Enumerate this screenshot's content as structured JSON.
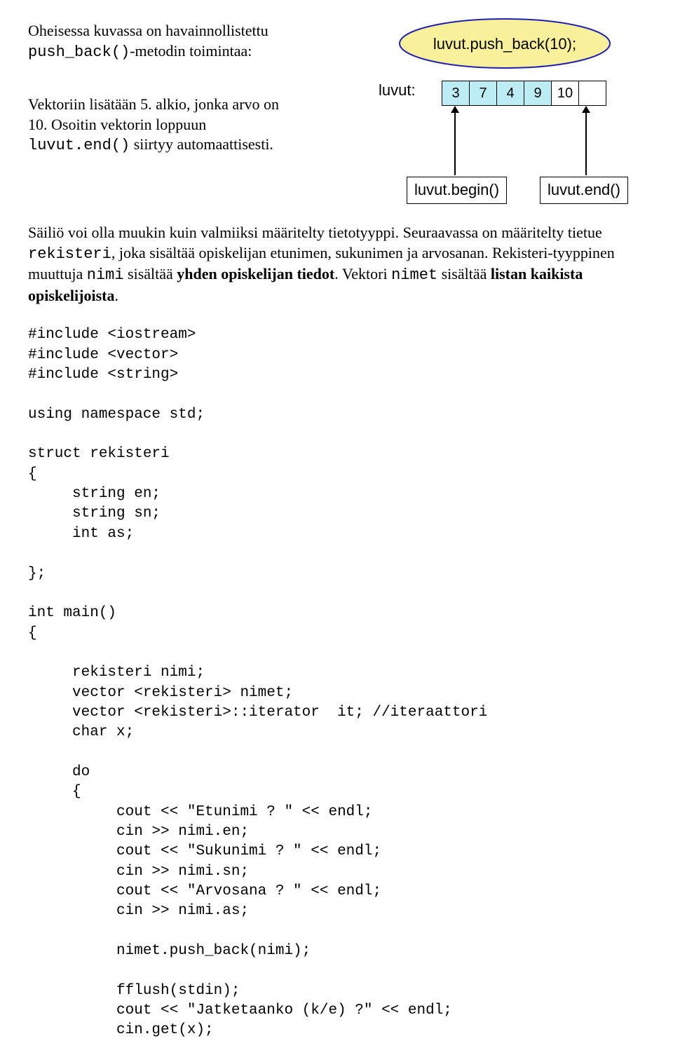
{
  "intro": {
    "p1_a": "Oheisessa kuvassa on havainnollistettu ",
    "p1_code": "push_back()",
    "p1_b": "-metodin toimintaa:",
    "p2_a": "Vektoriin lisätään 5. alkio, jonka arvo on 10. Osoitin vektorin loppuun ",
    "p2_code": "luvut.end()",
    "p2_b": " siirtyy automaattisesti."
  },
  "diagram": {
    "ellipse_text": "luvut.push_back(10);",
    "label": "luvut:",
    "cells": [
      "3",
      "7",
      "4",
      "9",
      "10",
      ""
    ],
    "begin": "luvut.begin()",
    "end": "luvut.end()"
  },
  "body": {
    "a": "Säiliö voi olla muukin kuin valmiiksi määritelty tietotyyppi. Seuraavassa on määritelty tietue ",
    "code1": "rekisteri",
    "b": ", joka sisältää opiskelijan etunimen, sukunimen ja arvosanan. Rekisteri-tyyppinen muuttuja ",
    "code2": "nimi",
    "c": " sisältää ",
    "bold1": "yhden opiskelijan tiedot",
    "d": ". Vektori ",
    "code3": "nimet",
    "e": " sisältää ",
    "bold2": "listan kaikista opiskelijoista",
    "f": "."
  },
  "code": "#include <iostream>\n#include <vector>\n#include <string>\n\nusing namespace std;\n\nstruct rekisteri\n{\n     string en;\n     string sn;\n     int as;\n\n};\n\nint main()\n{\n\n     rekisteri nimi;\n     vector <rekisteri> nimet;\n     vector <rekisteri>::iterator  it; //iteraattori\n     char x;\n\n     do\n     {\n          cout << \"Etunimi ? \" << endl;\n          cin >> nimi.en;\n          cout << \"Sukunimi ? \" << endl;\n          cin >> nimi.sn;\n          cout << \"Arvosana ? \" << endl;\n          cin >> nimi.as;\n\n          nimet.push_back(nimi);\n\n          fflush(stdin);\n          cout << \"Jatketaanko (k/e) ?\" << endl;\n          cin.get(x);"
}
